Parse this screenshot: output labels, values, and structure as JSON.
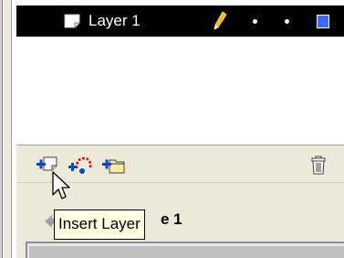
{
  "timeline": {
    "layers": [
      {
        "name": "Layer 1",
        "color": "#3b6cff"
      }
    ]
  },
  "toolbar": {
    "insert_layer_icon": "insert-layer-icon",
    "guide_layer_icon": "add-motion-guide-icon",
    "folder_icon": "insert-layer-folder-icon",
    "delete_icon": "trash-icon"
  },
  "tooltip": {
    "text": "Insert Layer"
  },
  "scene": {
    "label_fragment": "e 1"
  }
}
